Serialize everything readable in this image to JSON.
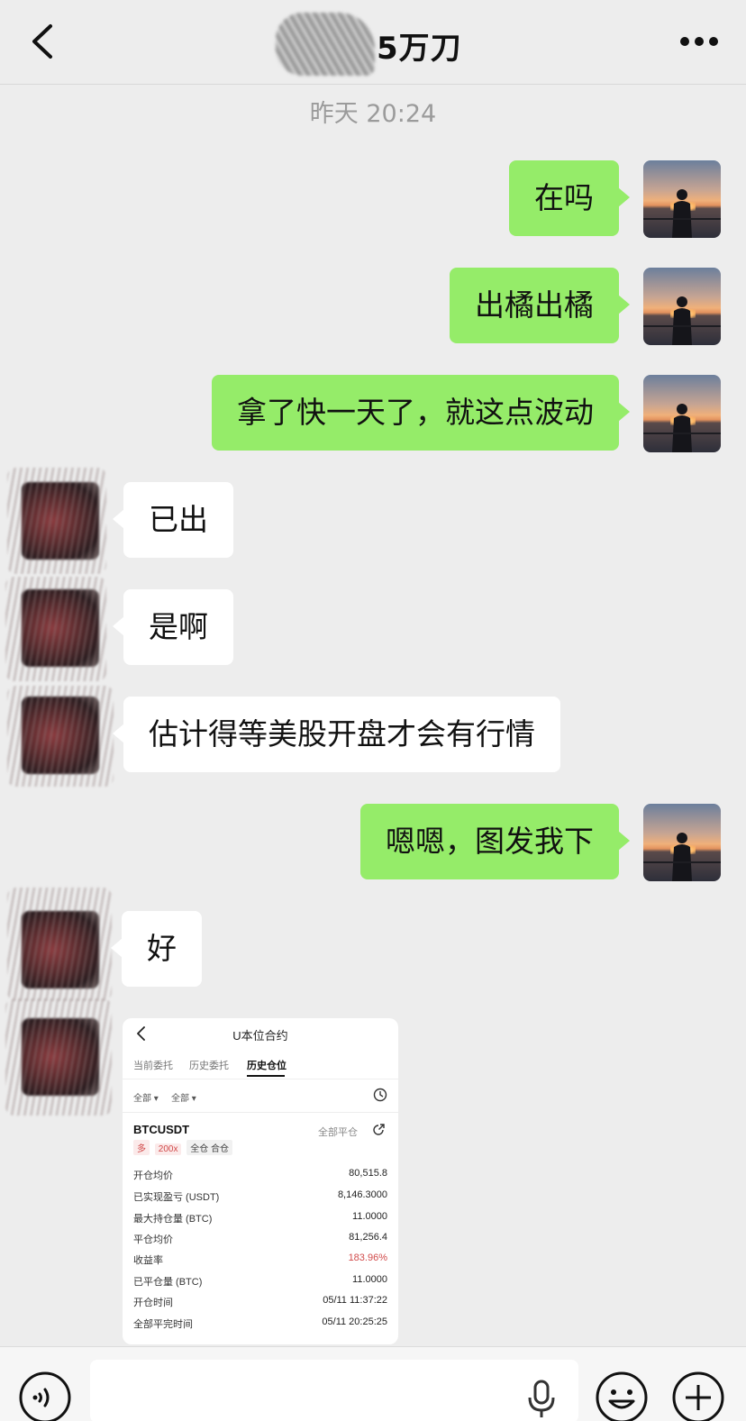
{
  "header": {
    "title_visible": "5万刀",
    "back_icon": "chevron-left-icon",
    "more_icon": "more-dots-icon"
  },
  "timestamp": "昨天 20:24",
  "messages": [
    {
      "from": "self",
      "text": "在吗"
    },
    {
      "from": "self",
      "text": "出橘出橘"
    },
    {
      "from": "self",
      "text": "拿了快一天了，就这点波动"
    },
    {
      "from": "other",
      "text": "已出"
    },
    {
      "from": "other",
      "text": "是啊"
    },
    {
      "from": "other",
      "text": "估计得等美股开盘才会有行情"
    },
    {
      "from": "self",
      "text": "嗯嗯，图发我下"
    },
    {
      "from": "other",
      "text": "好"
    }
  ],
  "shared_image": {
    "title": "U本位合约",
    "tabs": [
      "当前委托",
      "历史委托",
      "历史仓位"
    ],
    "active_tab": "历史仓位",
    "filters": [
      "全部 ▾",
      "全部 ▾"
    ],
    "symbol": "BTCUSDT",
    "close_all_label": "全部平仓",
    "tags": {
      "side": "多",
      "leverage": "200x",
      "mode": "全仓 合仓"
    },
    "rows": [
      {
        "label": "开仓均价",
        "value": "80,515.8"
      },
      {
        "label": "已实现盈亏 (USDT)",
        "value": "8,146.3000"
      },
      {
        "label": "最大持仓量 (BTC)",
        "value": "11.0000"
      },
      {
        "label": "平仓均价",
        "value": "81,256.4"
      },
      {
        "label": "收益率",
        "value": "183.96%"
      },
      {
        "label": "已平仓量 (BTC)",
        "value": "11.0000"
      },
      {
        "label": "开仓时间",
        "value": "05/11 11:37:22"
      },
      {
        "label": "全部平完时间",
        "value": "05/11 20:25:25"
      }
    ],
    "highlight_color": "#d14a4a"
  },
  "colors": {
    "self_bubble": "#95ec69",
    "other_bubble": "#ffffff",
    "background": "#ededed"
  }
}
